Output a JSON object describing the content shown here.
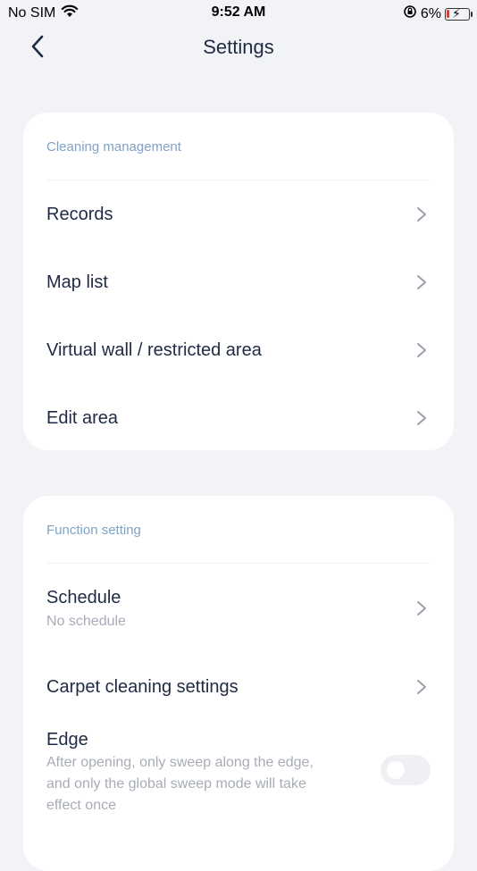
{
  "status": {
    "carrier": "No SIM",
    "time": "9:52 AM",
    "battery": "6%"
  },
  "header": {
    "title": "Settings"
  },
  "cleaning": {
    "section_title": "Cleaning management",
    "items": [
      {
        "label": "Records"
      },
      {
        "label": "Map list"
      },
      {
        "label": "Virtual wall / restricted area"
      },
      {
        "label": "Edit area"
      }
    ]
  },
  "function": {
    "section_title": "Function setting",
    "schedule": {
      "label": "Schedule",
      "sub": "No schedule"
    },
    "carpet": {
      "label": "Carpet cleaning settings"
    },
    "edge": {
      "label": "Edge",
      "sub": "After opening, only sweep along the edge, and only the global sweep mode will take effect once",
      "enabled": false
    }
  },
  "colors": {
    "accent_text": "#7fa3c8",
    "primary_text": "#1f2a44",
    "secondary_text": "#a7acb7",
    "battery_low": "#e53935"
  }
}
